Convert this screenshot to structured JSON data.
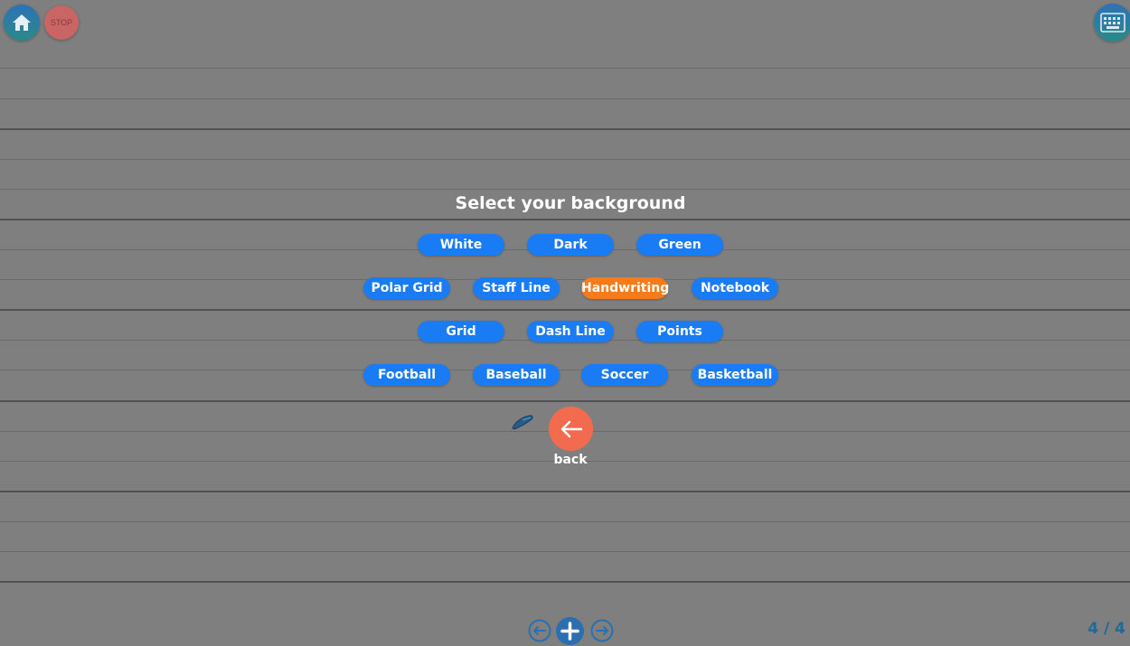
{
  "toolbar": {
    "home_icon": "home-icon",
    "stop_label": "STOP",
    "keyboard_icon": "keyboard-icon"
  },
  "dialog": {
    "title": "Select your background",
    "options": {
      "white": "White",
      "dark": "Dark",
      "green": "Green",
      "polar_grid": "Polar Grid",
      "staff_line": "Staff Line",
      "handwriting": "Handwriting",
      "notebook": "Notebook",
      "grid": "Grid",
      "dash_line": "Dash Line",
      "points": "Points",
      "football": "Football",
      "baseball": "Baseball",
      "soccer": "Soccer",
      "basketball": "Basketball"
    },
    "selected": "Handwriting",
    "back_label": "back"
  },
  "pager": {
    "counter": "4 / 4",
    "prev_icon": "arrow-left-circle-icon",
    "add_icon": "plus-circle-icon",
    "next_icon": "arrow-right-circle-icon"
  },
  "colors": {
    "background": "#7f7f80",
    "pill": "#1a7cf5",
    "pill_selected": "#f77a1b",
    "back_button": "#f36b4e"
  }
}
